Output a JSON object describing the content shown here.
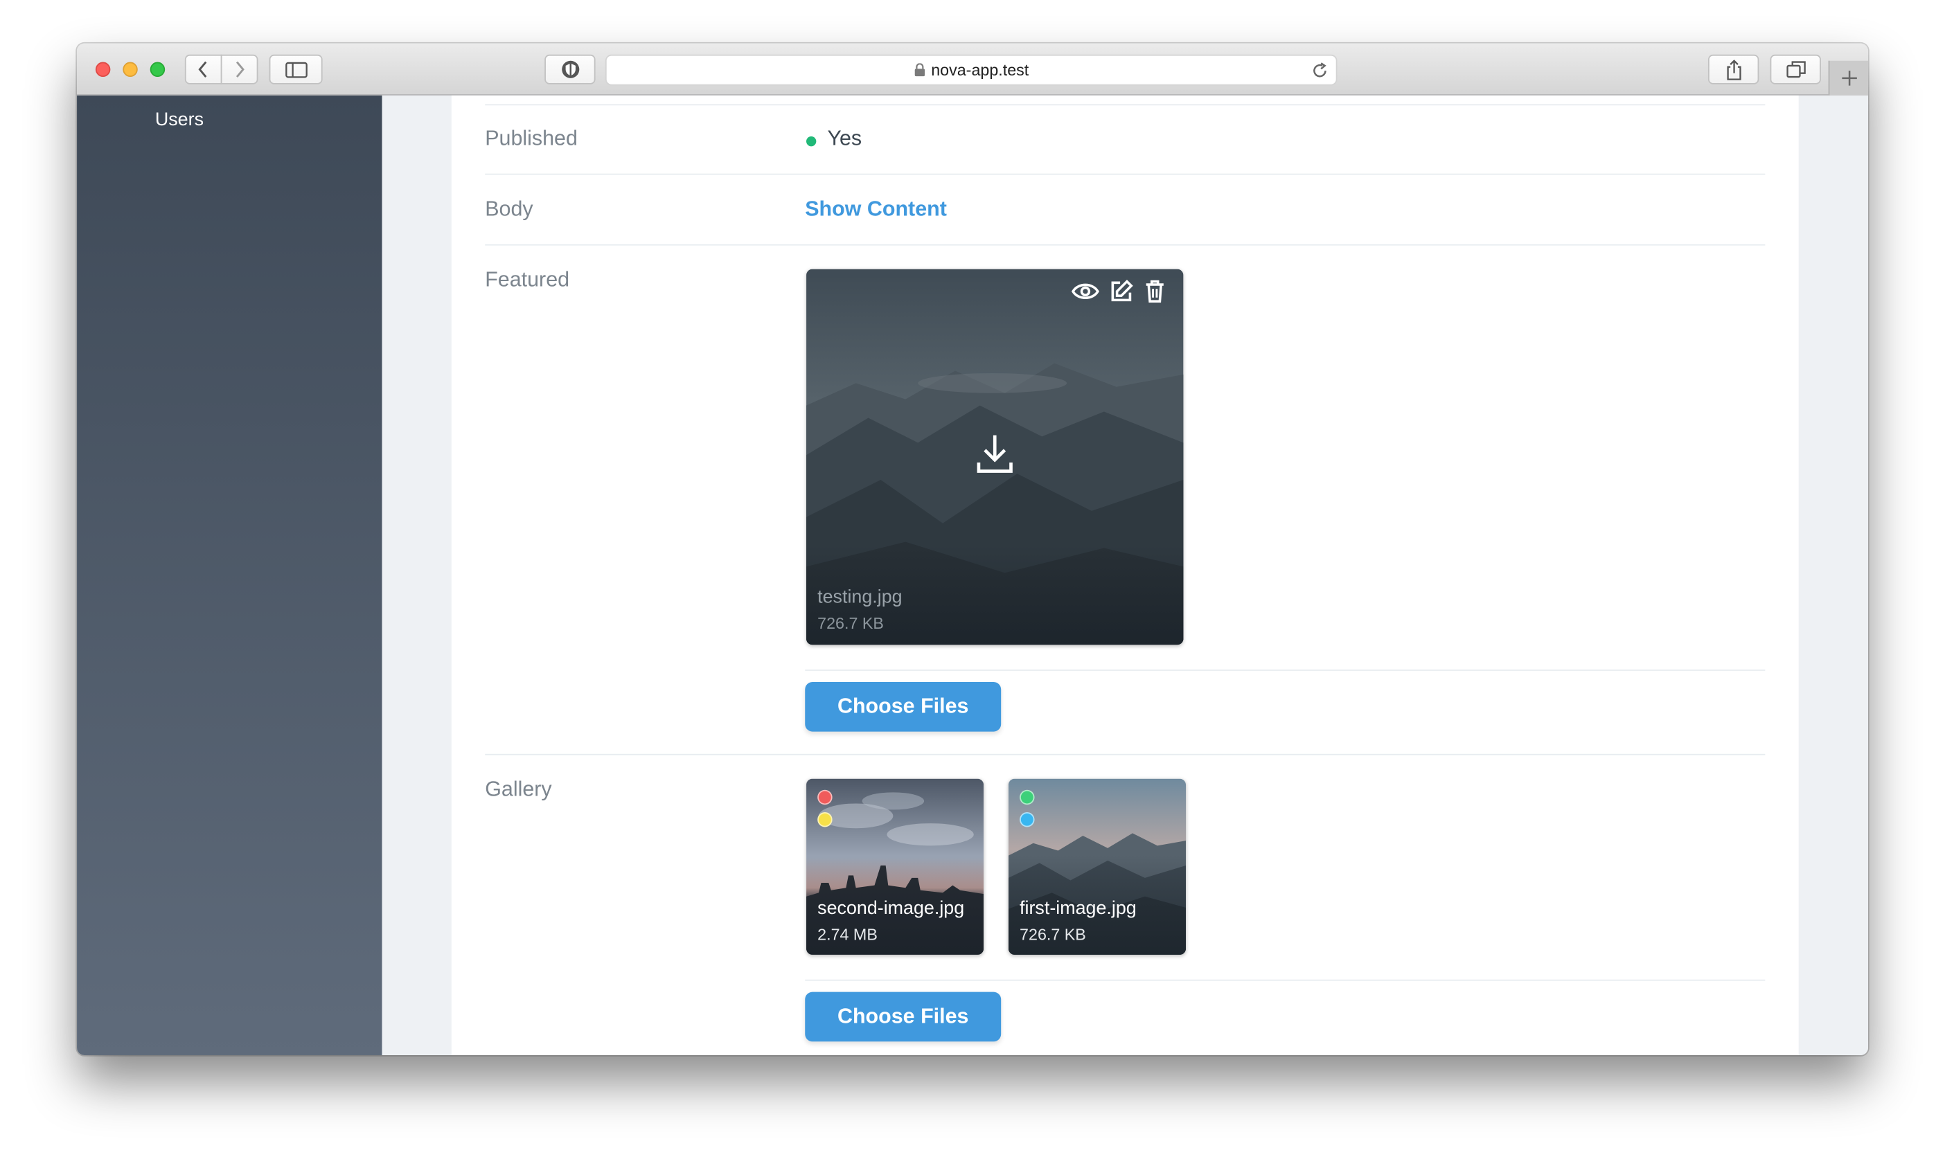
{
  "browser": {
    "url": "nova-app.test"
  },
  "sidebar": {
    "items": [
      {
        "label": "Users"
      }
    ]
  },
  "fields": {
    "published": {
      "label": "Published",
      "value": "Yes",
      "status_color": "#21b978"
    },
    "body": {
      "label": "Body",
      "link": "Show Content"
    },
    "featured": {
      "label": "Featured",
      "file": {
        "name": "testing.jpg",
        "size": "726.7 KB"
      },
      "actions": [
        "eye-icon",
        "edit-icon",
        "trash-icon"
      ],
      "button": "Choose Files"
    },
    "gallery": {
      "label": "Gallery",
      "files": [
        {
          "name": "second-image.jpg",
          "size": "2.74 MB",
          "dots": [
            "#f05b5b",
            "#f7e049"
          ]
        },
        {
          "name": "first-image.jpg",
          "size": "726.7 KB",
          "dots": [
            "#3dd07a",
            "#38b6f0"
          ]
        }
      ],
      "button": "Choose Files"
    }
  },
  "colors": {
    "accent": "#4099de",
    "sidebar": "#4b5666",
    "page_bg": "#eef1f4"
  }
}
